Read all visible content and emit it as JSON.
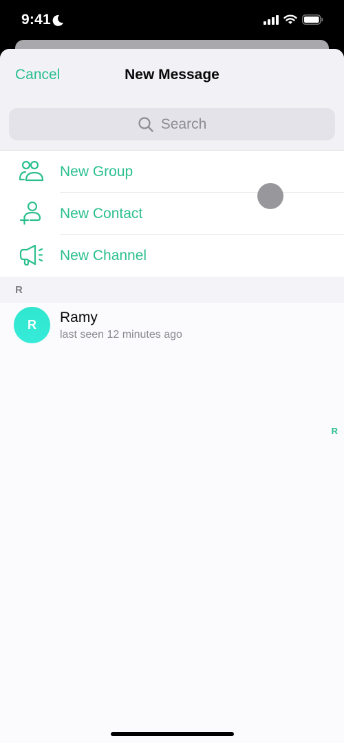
{
  "status_bar": {
    "time": "9:41",
    "icons": [
      "moon-icon",
      "cellular-signal-icon",
      "wifi-icon",
      "battery-icon"
    ]
  },
  "nav": {
    "cancel_label": "Cancel",
    "title": "New Message"
  },
  "search": {
    "placeholder": "Search",
    "icon": "search-icon"
  },
  "actions": [
    {
      "label": "New Group",
      "icon": "group-icon"
    },
    {
      "label": "New Contact",
      "icon": "add-contact-icon"
    },
    {
      "label": "New Channel",
      "icon": "megaphone-icon"
    }
  ],
  "sections": [
    {
      "letter": "R",
      "contacts": [
        {
          "initial": "R",
          "name": "Ramy",
          "status": "last seen 12 minutes ago"
        }
      ]
    }
  ],
  "index": [
    "R"
  ],
  "colors": {
    "accent": "#2bbf8f",
    "avatar": "#34e8d4"
  }
}
